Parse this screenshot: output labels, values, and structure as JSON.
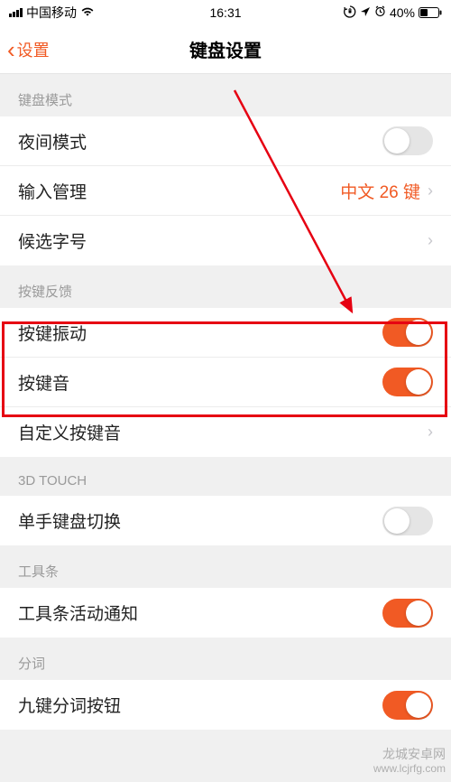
{
  "status": {
    "carrier": "中国移动",
    "time": "16:31",
    "battery_pct": "40%"
  },
  "nav": {
    "back_label": "设置",
    "title": "键盘设置"
  },
  "sections": {
    "mode": {
      "header": "键盘模式",
      "night_mode": "夜间模式",
      "input_mgmt": "输入管理",
      "input_mgmt_value": "中文 26 键",
      "candidate_size": "候选字号"
    },
    "feedback": {
      "header": "按键反馈",
      "vibrate": "按键振动",
      "sound": "按键音",
      "custom_sound": "自定义按键音"
    },
    "touch3d": {
      "header": "3D TOUCH",
      "one_hand": "单手键盘切换"
    },
    "toolbar": {
      "header": "工具条",
      "activity_notice": "工具条活动通知"
    },
    "segmentation": {
      "header": "分词",
      "nine_key": "九键分词按钮"
    }
  },
  "watermark": {
    "name": "龙城安卓网",
    "url": "www.lcjrfg.com"
  }
}
